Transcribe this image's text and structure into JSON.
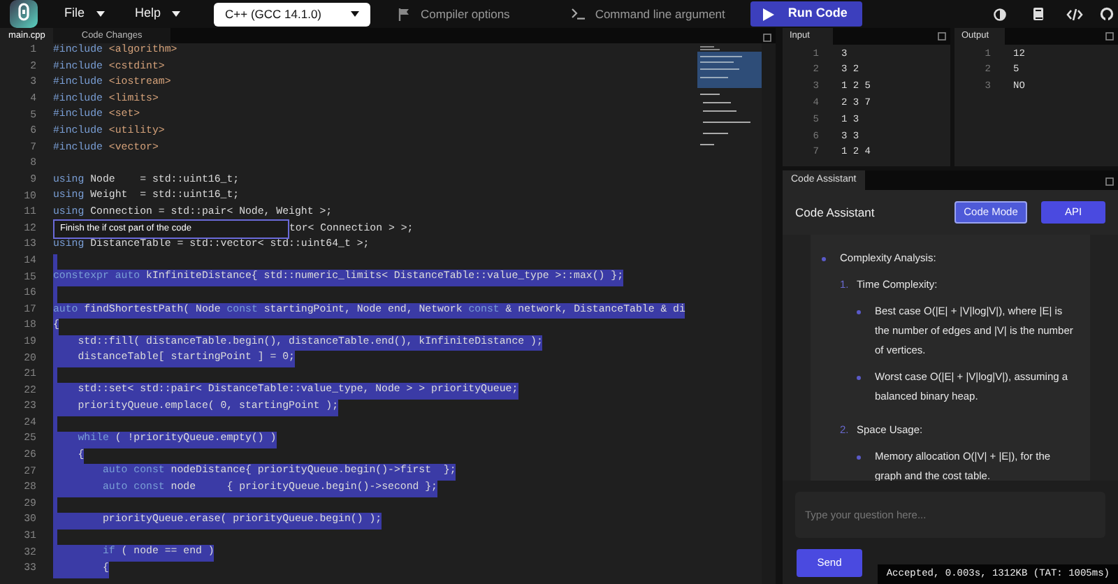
{
  "menu": {
    "items": [
      {
        "label": "File"
      },
      {
        "label": "Help"
      }
    ],
    "language": "C++ (GCC 14.1.0)",
    "compiler_options": "Compiler options",
    "command_line": "Command line argument",
    "run": "Run Code"
  },
  "editor": {
    "tabs": [
      {
        "label": "main.cpp",
        "selected": true
      },
      {
        "label": "Code Changes",
        "selected": false
      }
    ],
    "lines": [
      {
        "num": "1",
        "selected": false,
        "parts": [
          {
            "kind": "keyword",
            "text": "#include"
          },
          {
            "kind": "string",
            "text": " <algorithm>"
          }
        ]
      },
      {
        "num": "2",
        "selected": false,
        "parts": [
          {
            "kind": "keyword",
            "text": "#include"
          },
          {
            "kind": "string",
            "text": " <cstdint>"
          }
        ]
      },
      {
        "num": "3",
        "selected": false,
        "parts": [
          {
            "kind": "keyword",
            "text": "#include"
          },
          {
            "kind": "string",
            "text": " <iostream>"
          }
        ]
      },
      {
        "num": "4",
        "selected": false,
        "parts": [
          {
            "kind": "keyword",
            "text": "#include"
          },
          {
            "kind": "string",
            "text": " <limits>"
          }
        ]
      },
      {
        "num": "5",
        "selected": false,
        "parts": [
          {
            "kind": "keyword",
            "text": "#include"
          },
          {
            "kind": "string",
            "text": " <set>"
          }
        ]
      },
      {
        "num": "6",
        "selected": false,
        "parts": [
          {
            "kind": "keyword",
            "text": "#include"
          },
          {
            "kind": "string",
            "text": " <utility>"
          }
        ]
      },
      {
        "num": "7",
        "selected": false,
        "parts": [
          {
            "kind": "keyword",
            "text": "#include"
          },
          {
            "kind": "string",
            "text": " <vector>"
          }
        ]
      },
      {
        "num": "8",
        "selected": false
      },
      {
        "num": "9",
        "selected": false,
        "parts": [
          {
            "kind": "keyword",
            "text": "using"
          },
          {
            "kind": "plain",
            "text": " Node    = std::uint16_t;"
          }
        ]
      },
      {
        "num": "10",
        "selected": false,
        "parts": [
          {
            "kind": "keyword",
            "text": "using"
          },
          {
            "kind": "plain",
            "text": " Weight  = std::uint16_t;"
          }
        ]
      },
      {
        "num": "11",
        "selected": false,
        "parts": [
          {
            "kind": "keyword",
            "text": "using"
          },
          {
            "kind": "plain",
            "text": " Connection = std::pair< Node, Weight >;"
          }
        ]
      },
      {
        "num": "12",
        "selected": false,
        "hint": "Finish the if cost part of the code",
        "parts": [
          {
            "kind": "plain",
            "text": "tor< Connection > >;"
          }
        ]
      },
      {
        "num": "13",
        "selected": false,
        "parts": [
          {
            "kind": "keyword",
            "text": "using"
          },
          {
            "kind": "plain",
            "text": " DistanceTable = std::vector< std::uint64_t >;"
          }
        ]
      },
      {
        "num": "14",
        "selected": true
      },
      {
        "num": "15",
        "selected": true,
        "parts": [
          {
            "kind": "keyword",
            "text": "constexpr auto"
          },
          {
            "kind": "plain",
            "text": " kInfiniteDistance{ std::numeric_limits< DistanceTable::value_type >::max() };"
          }
        ]
      },
      {
        "num": "16",
        "selected": true
      },
      {
        "num": "17",
        "selected": true,
        "parts": [
          {
            "kind": "keyword",
            "text": "auto"
          },
          {
            "kind": "plain",
            "text": " findShortestPath( Node "
          },
          {
            "kind": "keyword",
            "text": "const"
          },
          {
            "kind": "plain",
            "text": " startingPoint, Node end, Network "
          },
          {
            "kind": "keyword",
            "text": "const"
          },
          {
            "kind": "plain",
            "text": " & network, DistanceTable & di"
          }
        ]
      },
      {
        "num": "18",
        "selected": true,
        "parts": [
          {
            "kind": "plain",
            "text": "{"
          }
        ]
      },
      {
        "num": "19",
        "selected": true,
        "parts": [
          {
            "kind": "plain",
            "text": "    std::fill( distanceTable.begin(), distanceTable.end(), kInfiniteDistance );"
          }
        ]
      },
      {
        "num": "20",
        "selected": true,
        "parts": [
          {
            "kind": "plain",
            "text": "    distanceTable[ startingPoint ] = 0;"
          }
        ]
      },
      {
        "num": "21",
        "selected": true
      },
      {
        "num": "22",
        "selected": true,
        "parts": [
          {
            "kind": "plain",
            "text": "    std::set< std::pair< DistanceTable::value_type, Node > > priorityQueue;"
          }
        ]
      },
      {
        "num": "23",
        "selected": true,
        "parts": [
          {
            "kind": "plain",
            "text": "    priorityQueue.emplace( 0, startingPoint );"
          }
        ]
      },
      {
        "num": "24",
        "selected": true
      },
      {
        "num": "25",
        "selected": true,
        "parts": [
          {
            "kind": "keyword",
            "text": "    while"
          },
          {
            "kind": "plain",
            "text": " ( !priorityQueue.empty() )"
          }
        ]
      },
      {
        "num": "26",
        "selected": true,
        "parts": [
          {
            "kind": "plain",
            "text": "    {"
          }
        ]
      },
      {
        "num": "27",
        "selected": true,
        "parts": [
          {
            "kind": "keyword",
            "text": "        auto const"
          },
          {
            "kind": "plain",
            "text": " nodeDistance{ priorityQueue.begin()->first  };"
          }
        ]
      },
      {
        "num": "28",
        "selected": true,
        "parts": [
          {
            "kind": "keyword",
            "text": "        auto const"
          },
          {
            "kind": "plain",
            "text": " node     { priorityQueue.begin()->second };"
          }
        ]
      },
      {
        "num": "29",
        "selected": true
      },
      {
        "num": "30",
        "selected": true,
        "parts": [
          {
            "kind": "plain",
            "text": "        priorityQueue.erase( priorityQueue.begin() );"
          }
        ]
      },
      {
        "num": "31",
        "selected": true
      },
      {
        "num": "32",
        "selected": true,
        "parts": [
          {
            "kind": "keyword",
            "text": "        if"
          },
          {
            "kind": "plain",
            "text": " ( node == end )"
          }
        ]
      },
      {
        "num": "33",
        "selected": true,
        "parts": [
          {
            "kind": "plain",
            "text": "        {"
          }
        ]
      }
    ]
  },
  "input": {
    "title": "Input",
    "lines": [
      {
        "num": "1",
        "text": "3"
      },
      {
        "num": "2",
        "text": "3 2"
      },
      {
        "num": "3",
        "text": "1 2 5"
      },
      {
        "num": "4",
        "text": "2 3 7"
      },
      {
        "num": "5",
        "text": "1 3"
      },
      {
        "num": "6",
        "text": "3 3"
      },
      {
        "num": "7",
        "text": "1 2 4"
      }
    ]
  },
  "output": {
    "title": "Output",
    "lines": [
      {
        "num": "1",
        "text": "12"
      },
      {
        "num": "2",
        "text": "5"
      },
      {
        "num": "3",
        "text": "NO"
      }
    ]
  },
  "assistant": {
    "tab": "Code Assistant",
    "title": "Code Assistant",
    "modes": [
      {
        "label": "Code Mode",
        "selected": true
      },
      {
        "label": "API",
        "selected": false
      }
    ],
    "content": [
      {
        "kind": "bullet",
        "text": "Complexity Analysis:",
        "children": [
          {
            "kind": "numbered",
            "marker": "1.",
            "text": "Time Complexity:",
            "children": [
              {
                "kind": "bullet",
                "text": "Best case O(|E| + |V|log|V|), where |E| is the number of edges and |V| is the number of vertices."
              },
              {
                "kind": "bullet",
                "text": "Worst case O(|E| + |V|log|V|), assuming a balanced binary heap."
              }
            ]
          },
          {
            "kind": "numbered",
            "marker": "2.",
            "text": "Space Usage:",
            "children": [
              {
                "kind": "bullet",
                "text": "Memory allocation O(|V| + |E|), for the graph and the cost table."
              }
            ]
          }
        ]
      }
    ],
    "placeholder": "Type your question here...",
    "send": "Send"
  },
  "status": "Accepted, 0.003s, 1312KB (TAT: 1005ms)"
}
